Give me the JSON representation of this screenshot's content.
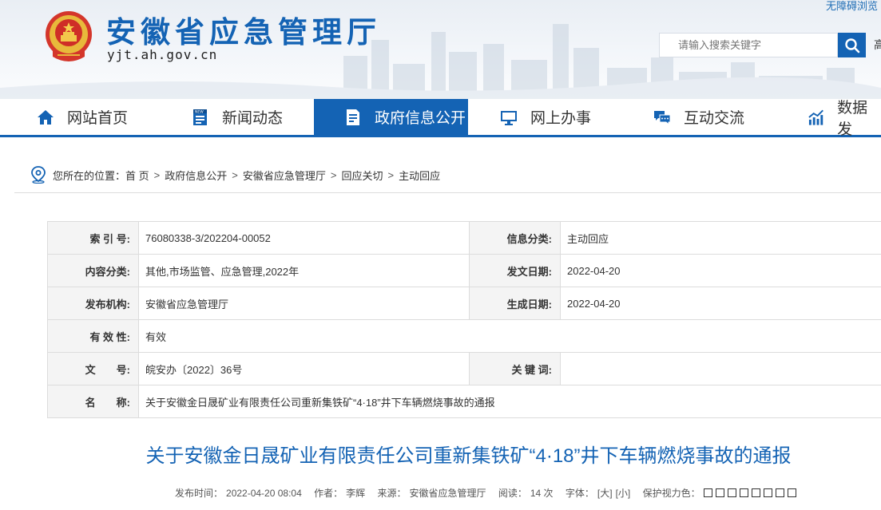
{
  "header": {
    "accessibility": "无障碍浏览",
    "site_title": "安徽省应急管理厅",
    "domain": "yjt.ah.gov.cn",
    "search_placeholder": "请输入搜索关键字",
    "edge_char": "高",
    "brand_color": "#1463b4"
  },
  "nav": {
    "items": [
      {
        "label": "网站首页",
        "icon": "home-icon"
      },
      {
        "label": "新闻动态",
        "icon": "news-icon"
      },
      {
        "label": "政府信息公开",
        "icon": "document-icon",
        "active": true
      },
      {
        "label": "网上办事",
        "icon": "monitor-icon"
      },
      {
        "label": "互动交流",
        "icon": "chat-icon"
      },
      {
        "label": "数据发",
        "icon": "chart-icon"
      }
    ]
  },
  "breadcrumb": {
    "prefix": "您所在的位置：",
    "items": [
      "首 页",
      "政府信息公开",
      "安徽省应急管理厅",
      "回应关切",
      "主动回应"
    ],
    "separator": ">"
  },
  "info": {
    "index_label": "索 引 号:",
    "index_value": "76080338-3/202204-00052",
    "category_label": "信息分类:",
    "category_value": "主动回应",
    "content_label": "内容分类:",
    "content_value": "其他,市场监管、应急管理,2022年",
    "date_label": "发文日期:",
    "date_value": "2022-04-20",
    "org_label": "发布机构:",
    "org_value": "安徽省应急管理厅",
    "gen_label": "生成日期:",
    "gen_value": "2022-04-20",
    "validity_label": "有 效 性:",
    "validity_value": "有效",
    "doc_label": "文　　号:",
    "doc_value": "皖安办〔2022〕36号",
    "keyword_label": "关 键 词:",
    "keyword_value": "",
    "name_label": "名　　称:",
    "name_value": "关于安徽金日晟矿业有限责任公司重新集铁矿“4·18”井下车辆燃烧事故的通报"
  },
  "article": {
    "title": "关于安徽金日晟矿业有限责任公司重新集铁矿“4·18”井下车辆燃烧事故的通报",
    "publish_label": "发布时间：",
    "publish_time": "2022-04-20 08:04",
    "author_label": "作者：",
    "author": "李辉",
    "source_label": "来源：",
    "source": "安徽省应急管理厅",
    "views_label": "阅读：",
    "views": "14 次",
    "font_label": "字体：",
    "font_large": "[大]",
    "font_small": "[小]",
    "eye_label": "保护视力色："
  }
}
